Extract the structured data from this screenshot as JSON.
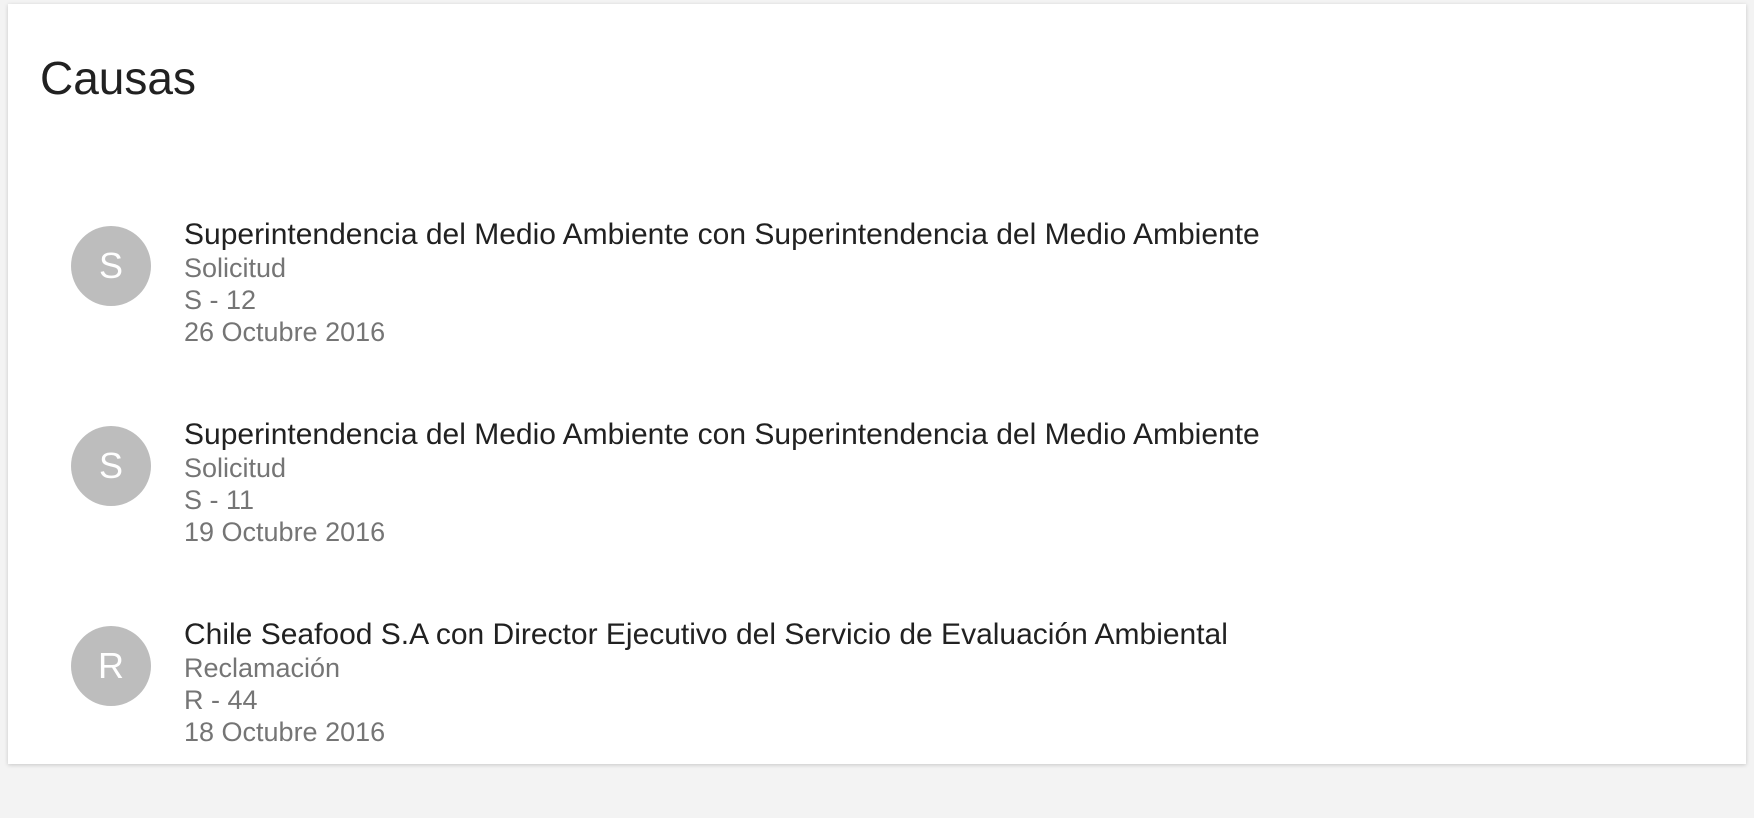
{
  "page": {
    "title": "Causas"
  },
  "cases": [
    {
      "avatar_letter": "S",
      "title": "Superintendencia del Medio Ambiente con Superintendencia del Medio Ambiente",
      "type": "Solicitud",
      "code": "S - 12",
      "date": "26 Octubre 2016"
    },
    {
      "avatar_letter": "S",
      "title": "Superintendencia del Medio Ambiente con Superintendencia del Medio Ambiente",
      "type": "Solicitud",
      "code": "S - 11",
      "date": "19 Octubre 2016"
    },
    {
      "avatar_letter": "R",
      "title": "Chile Seafood S.A con Director Ejecutivo del Servicio de Evaluación Ambiental",
      "type": "Reclamación",
      "code": "R - 44",
      "date": "18 Octubre 2016"
    }
  ],
  "colors": {
    "avatar_background": "#bdbdbd",
    "title_text": "#212121",
    "secondary_text": "#757575"
  }
}
